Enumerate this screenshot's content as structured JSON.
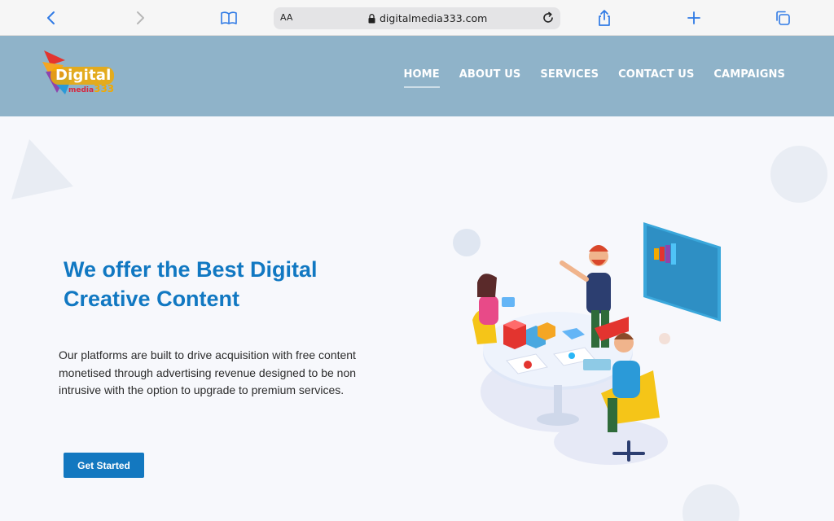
{
  "browser": {
    "url": "digitalmedia333.com",
    "text_size_label": "AA",
    "icons": [
      "back-icon",
      "forward-icon",
      "bookmarks-icon",
      "lock-icon",
      "reload-icon",
      "share-icon",
      "new-tab-icon",
      "tabs-icon"
    ]
  },
  "site": {
    "logo": {
      "word": "Digital",
      "sub": "media",
      "num": "333"
    },
    "nav": [
      {
        "label": "HOME",
        "active": true
      },
      {
        "label": "ABOUT US",
        "active": false
      },
      {
        "label": "SERVICES",
        "active": false
      },
      {
        "label": "CONTACT US",
        "active": false
      },
      {
        "label": "CAMPAIGNS",
        "active": false
      }
    ],
    "colors": {
      "header_bg": "#8fb3c9",
      "accent": "#1178c2",
      "button_bg": "#1378c0",
      "page_bg": "#f7f8fc"
    }
  },
  "hero": {
    "title": "We offer the Best Digital Creative Content",
    "description": "Our platforms are built to drive acquisition with free content monetised through advertising revenue designed to be non intrusive with the option to upgrade to premium services.",
    "cta_label": "Get Started"
  }
}
